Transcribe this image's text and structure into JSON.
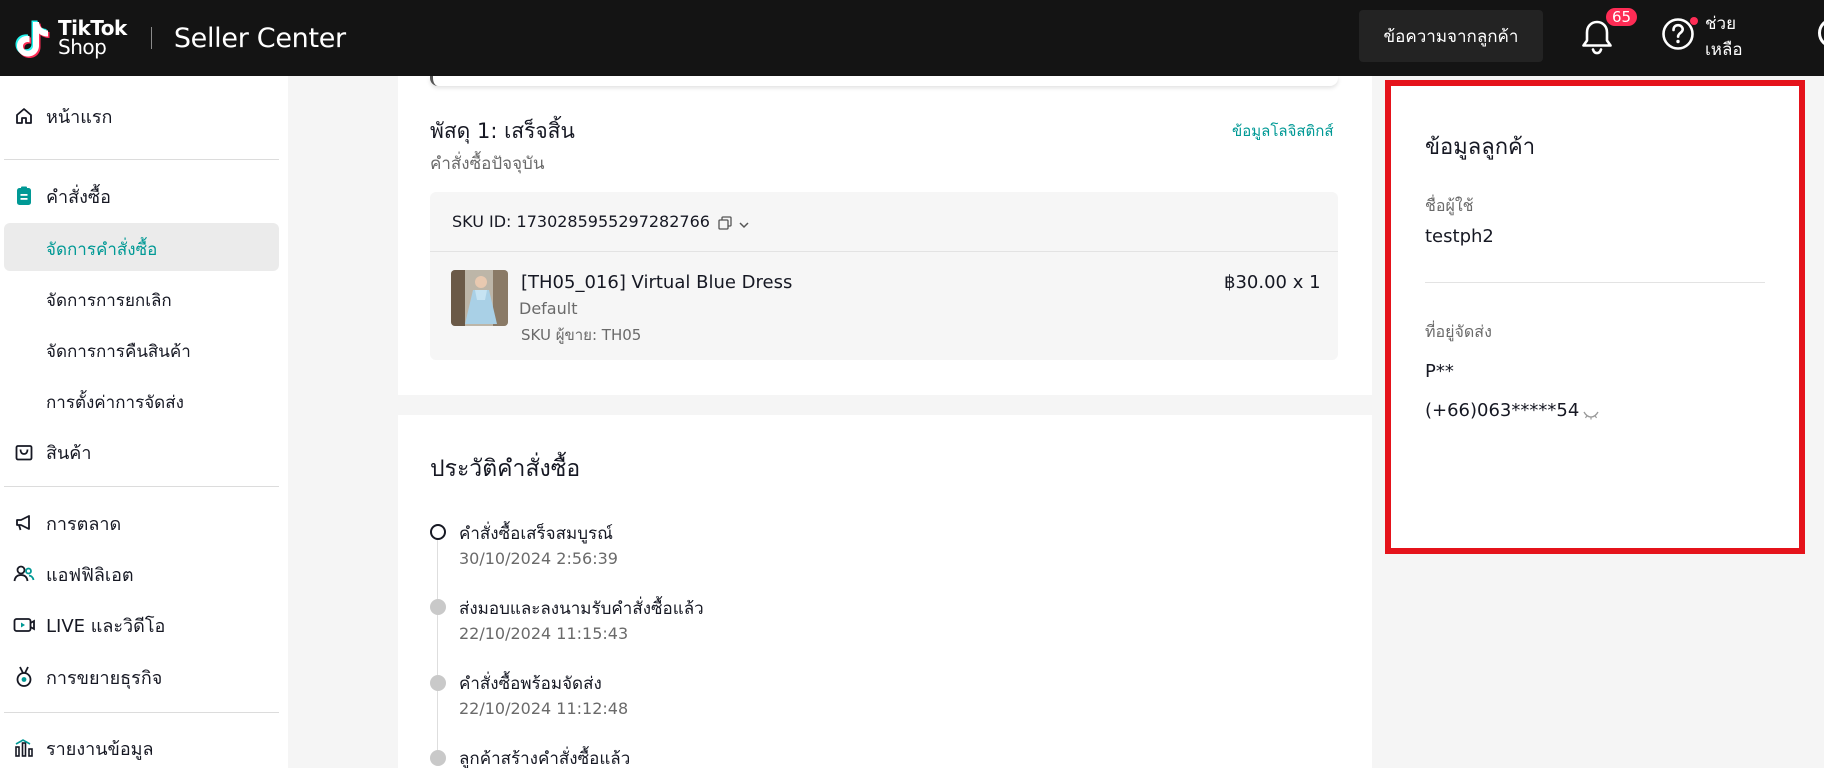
{
  "header": {
    "brand_line1": "TikTok",
    "brand_line2": "Shop",
    "title": "Seller Center",
    "customer_messages_label": "ข้อความจากลูกค้า",
    "notification_count": "65",
    "help_label_line1": "ช่วย",
    "help_label_line2": "เหลือ"
  },
  "sidebar": {
    "home": "หน้าแรก",
    "orders": "คำสั่งซื้อ",
    "orders_sub": {
      "manage_orders": "จัดการคำสั่งซื้อ",
      "manage_cancellations": "จัดการการยกเลิก",
      "manage_returns": "จัดการการคืนสินค้า",
      "shipping_settings": "การตั้งค่าการจัดส่ง"
    },
    "products": "สินค้า",
    "marketing": "การตลาด",
    "affiliate": "แอฟฟิลิเอต",
    "live_video": "LIVE และวิดีโอ",
    "growth": "การขยายธุรกิจ",
    "data_reports": "รายงานข้อมูล"
  },
  "package": {
    "title": "พัสดุ 1: เสร็จสิ้น",
    "subtitle": "คำสั่งซื้อปัจจุบัน",
    "logistics_link": "ข้อมูลโลจิสติกส์",
    "sku_id_label": "SKU ID: 1730285955297282766",
    "item": {
      "name": "[TH05_016] Virtual Blue Dress",
      "variant": "Default",
      "seller_sku": "SKU ผู้ขาย: TH05",
      "price_qty": "฿30.00 x 1"
    }
  },
  "history": {
    "title": "ประวัติคำสั่งซื้อ",
    "events": [
      {
        "title": "คำสั่งซื้อเสร็จสมบูรณ์",
        "time": "30/10/2024 2:56:39"
      },
      {
        "title": "ส่งมอบและลงนามรับคำสั่งซื้อแล้ว",
        "time": "22/10/2024 11:15:43"
      },
      {
        "title": "คำสั่งซื้อพร้อมจัดส่ง",
        "time": "22/10/2024 11:12:48"
      },
      {
        "title": "ลูกค้าสร้างคำสั่งซื้อแล้ว",
        "time": ""
      }
    ]
  },
  "customer": {
    "title": "ข้อมูลลูกค้า",
    "username_label": "ชื่อผู้ใช้",
    "username": "testph2",
    "address_label": "ที่อยู่จัดส่ง",
    "recipient": "P**",
    "phone": "(+66)063*****54"
  },
  "colors": {
    "accent": "#009995",
    "highlight_border": "#e5131b",
    "header_bg": "#141414",
    "badge": "#fe2c55"
  },
  "icons": {
    "home": "home-icon",
    "orders": "clipboard-icon",
    "products": "shopping-bag-icon",
    "marketing": "megaphone-icon",
    "affiliate": "people-icon",
    "live_video": "video-icon",
    "growth": "medal-icon",
    "data_reports": "bar-chart-icon",
    "notifications": "bell-icon",
    "help": "question-circle-icon",
    "copy": "copy-icon",
    "expand": "chevron-down-icon",
    "mask": "eye-closed-icon"
  }
}
